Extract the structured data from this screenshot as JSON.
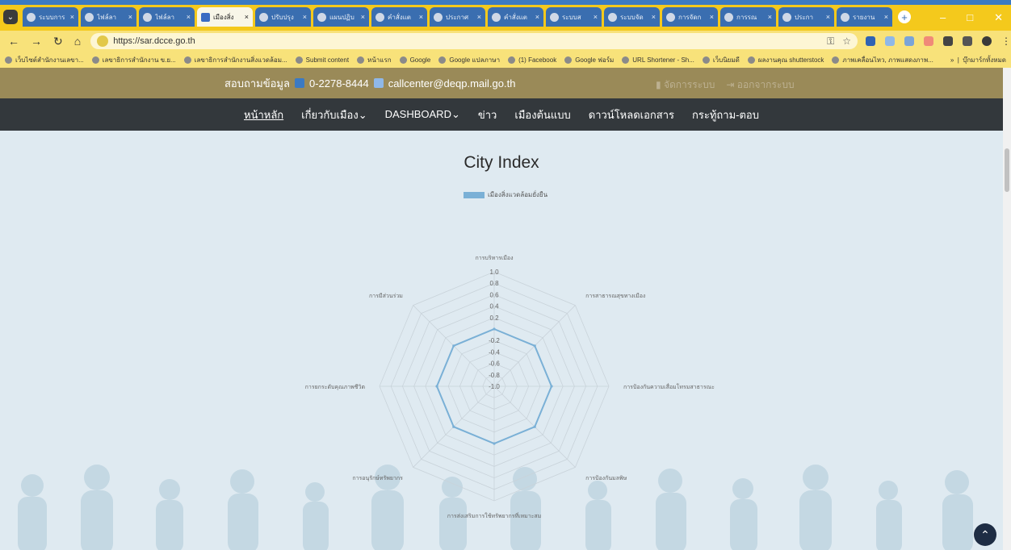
{
  "browser": {
    "tabs": [
      {
        "title": "ระบบการ",
        "active": false
      },
      {
        "title": "ไฟล์ลา",
        "active": false
      },
      {
        "title": "ไฟล์ลา",
        "active": false
      },
      {
        "title": "เมืองสิ่ง",
        "active": true
      },
      {
        "title": "ปรับปรุง",
        "active": false
      },
      {
        "title": "แผนปฏิบ",
        "active": false
      },
      {
        "title": "คำสั่งแต",
        "active": false
      },
      {
        "title": "ประกาศ",
        "active": false
      },
      {
        "title": "คำสั่งแต",
        "active": false
      },
      {
        "title": "ระบบส",
        "active": false
      },
      {
        "title": "ระบบจัด",
        "active": false
      },
      {
        "title": "การจัดก",
        "active": false
      },
      {
        "title": "การรณ",
        "active": false
      },
      {
        "title": "ประกา",
        "active": false
      },
      {
        "title": "รายงาน",
        "active": false
      }
    ],
    "close_glyph": "×",
    "new_tab_glyph": "+",
    "window_controls": [
      "–",
      "□",
      "✕"
    ],
    "url": "https://sar.dcce.go.th",
    "bookmarks": [
      "เว็บไซต์สำนักงานเลขา...",
      "เลขาธิการสำนักงาน ข.ย...",
      "เลขาธิการสำนักงานสิ่งแวดล้อม...",
      "Submit content",
      "หน้าแรก",
      "Google",
      "Google แปลภาษา",
      "(1) Facebook",
      "Google ฟอร์ม",
      "URL Shortener - Sh...",
      "เว็บนิยมดี",
      "ผลงานคุณ shutterstock",
      "ภาพเคลื่อนไหว, ภาพแสดงภาพ..."
    ],
    "bookmarks_more": "»",
    "all_bookmarks": "บุ๊กมาร์กทั้งหมด"
  },
  "site": {
    "contact_label": "สอบถามข้อมูล",
    "phone": "0-2278-8444",
    "email": "callcenter@deqp.mail.go.th",
    "manage": "จัดการระบบ",
    "logout": "ออกจากระบบ",
    "nav": [
      "หน้าหลัก",
      "เกี่ยวกับเมือง",
      "DASHBOARD",
      "ข่าว",
      "เมืองต้นแบบ",
      "ดาวน์โหลดเอกสาร",
      "กระทู้ถาม-ตอบ"
    ],
    "dropdown_glyph": "⌄"
  },
  "chart_data": {
    "type": "radar",
    "title": "City Index",
    "legend_position": "top",
    "series": [
      {
        "name": "เมืองสิ่งแวดล้อมยั่งยืน",
        "color": "#7ab0d6",
        "values": [
          0.0,
          0.0,
          0.0,
          0.0,
          0.0,
          0.0,
          0.0,
          0.0
        ]
      }
    ],
    "axes": [
      "การบริหารเมือง",
      "การสาธารณสุขทางเมือง",
      "การป้องกันความเสื่อมโทรมสาธารณะ",
      "การป้องกันมลพิษ",
      "การส่งเสริมการใช้ทรัพยากรที่เหมาะสม",
      "การอนุรักษ์ทรัพยากร",
      "การยกระดับคุณภาพชีวิต",
      "การมีส่วนร่วม"
    ],
    "ticks": [
      "1.0",
      "0.8",
      "0.6",
      "0.4",
      "0.2",
      "-0.2",
      "-0.4",
      "-0.6",
      "-0.8",
      "-1.0"
    ],
    "rlim": [
      -1.0,
      1.0
    ]
  },
  "colors": {
    "tab_strip": "#f4c91c",
    "site_header": "#9a8a58",
    "nav_bar": "#33383c",
    "series": "#7ab0d6",
    "content_bg": "#dfeaf1"
  }
}
